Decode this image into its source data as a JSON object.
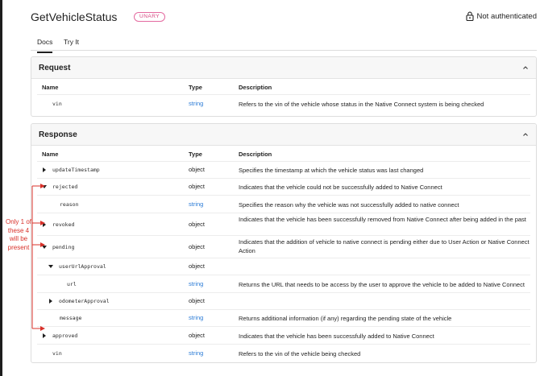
{
  "header": {
    "title": "GetVehicleStatus",
    "badge": "UNARY",
    "auth_label": "Not authenticated",
    "auth_icon": "lock-icon"
  },
  "tabs": [
    {
      "label": "Docs",
      "active": true
    },
    {
      "label": "Try It",
      "active": false
    }
  ],
  "request": {
    "title": "Request",
    "columns": {
      "name": "Name",
      "type": "Type",
      "description": "Description"
    },
    "rows": [
      {
        "name": "vin",
        "type": "string",
        "description": "Refers to the vin of the vehicle whose status in the Native Connect system is being checked"
      }
    ]
  },
  "response": {
    "title": "Response",
    "columns": {
      "name": "Name",
      "type": "Type",
      "description": "Description"
    },
    "rows": [
      {
        "name": "updateTimestamp",
        "type": "object",
        "description": "Specifies the timestamp at which the vehicle status was last changed",
        "expander": "collapsed"
      },
      {
        "name": "rejected",
        "type": "object",
        "description": "Indicates that the vehicle could not be successfully added to Native Connect",
        "expander": "expanded"
      },
      {
        "name": "reason",
        "type": "string",
        "description": "Specifies the reason why the vehicle was not successfully added to native connect",
        "expander": "none"
      },
      {
        "name": "revoked",
        "type": "object",
        "description": "Indicates that the vehicle has been successfully removed from Native Connect after being added in the past",
        "expander": "collapsed"
      },
      {
        "name": "pending",
        "type": "object",
        "description": "Indicates that the addition of vehicle to native connect is pending either due to User Action or Native Connect Action",
        "expander": "expanded"
      },
      {
        "name": "userUrlApproval",
        "type": "object",
        "description": "",
        "expander": "expanded"
      },
      {
        "name": "url",
        "type": "string",
        "description": "Returns the URL that needs to be access by the user to approve the vehicle to be added to Native Connect",
        "expander": "none"
      },
      {
        "name": "odometerApproval",
        "type": "object",
        "description": "",
        "expander": "collapsed"
      },
      {
        "name": "message",
        "type": "string",
        "description": "Returns additional information (if any) regarding the pending state of the vehicle",
        "expander": "none"
      },
      {
        "name": "approved",
        "type": "object",
        "description": "Indicates that the vehicle has been successfully added to Native Connect",
        "expander": "collapsed"
      },
      {
        "name": "vin",
        "type": "string",
        "description": "Refers to the vin of the vehicle being checked",
        "expander": "none"
      }
    ]
  },
  "annotation": {
    "text": "Only 1 of these 4 will be present",
    "color": "#d8312a"
  },
  "colors": {
    "badge": "#d6457f",
    "link_type": "#2b7bd6"
  }
}
